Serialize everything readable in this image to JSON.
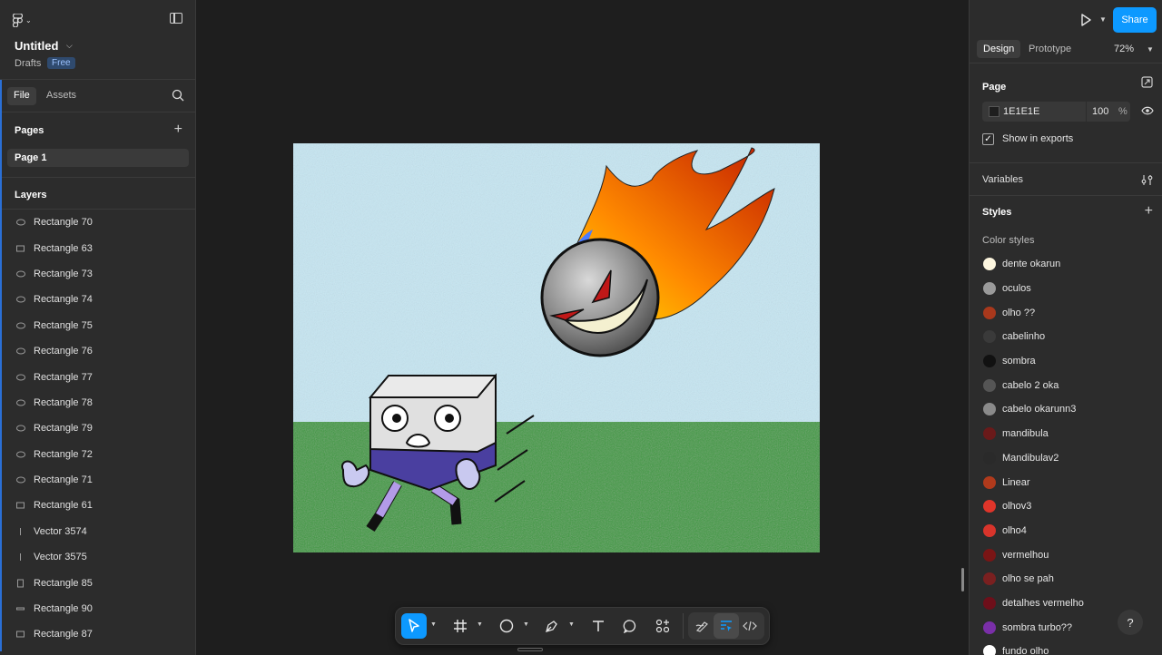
{
  "file": {
    "title": "Untitled",
    "location": "Drafts",
    "plan_badge": "Free"
  },
  "left_tabs": [
    {
      "label": "File"
    },
    {
      "label": "Assets"
    }
  ],
  "pages": {
    "title": "Pages",
    "items": [
      {
        "label": "Page 1"
      }
    ]
  },
  "layers": {
    "title": "Layers",
    "items": [
      {
        "label": "Rectangle 70",
        "icon": "ellipse"
      },
      {
        "label": "Rectangle 63",
        "icon": "rect"
      },
      {
        "label": "Rectangle 73",
        "icon": "ellipse"
      },
      {
        "label": "Rectangle 74",
        "icon": "ellipse"
      },
      {
        "label": "Rectangle 75",
        "icon": "ellipse"
      },
      {
        "label": "Rectangle 76",
        "icon": "ellipse"
      },
      {
        "label": "Rectangle 77",
        "icon": "ellipse"
      },
      {
        "label": "Rectangle 78",
        "icon": "ellipse"
      },
      {
        "label": "Rectangle 79",
        "icon": "ellipse"
      },
      {
        "label": "Rectangle 72",
        "icon": "ellipse"
      },
      {
        "label": "Rectangle 71",
        "icon": "ellipse"
      },
      {
        "label": "Rectangle 61",
        "icon": "rect"
      },
      {
        "label": "Vector 3574",
        "icon": "vector"
      },
      {
        "label": "Vector 3575",
        "icon": "vector"
      },
      {
        "label": "Rectangle 85",
        "icon": "rect-tall"
      },
      {
        "label": "Rectangle 90",
        "icon": "rect-thin"
      },
      {
        "label": "Rectangle 87",
        "icon": "rect"
      }
    ]
  },
  "header_right": {
    "share_label": "Share"
  },
  "right_tabs": [
    {
      "label": "Design"
    },
    {
      "label": "Prototype"
    }
  ],
  "zoom": "72%",
  "page_props": {
    "title": "Page",
    "bg_hex": "1E1E1E",
    "bg_color": "#1e1e1e",
    "opacity": "100",
    "opacity_unit": "%",
    "show_in_exports_label": "Show in exports",
    "show_in_exports": true
  },
  "variables": {
    "title": "Variables"
  },
  "styles": {
    "title": "Styles",
    "subtitle": "Color styles",
    "items": [
      {
        "label": "dente okarun",
        "color": "#fdf6df"
      },
      {
        "label": "oculos",
        "color": "#9a9a9a"
      },
      {
        "label": "olho ??",
        "color": "#a8381c"
      },
      {
        "label": "cabelinho",
        "color": "#3a3a3a"
      },
      {
        "label": "sombra",
        "color": "#111111"
      },
      {
        "label": "cabelo 2 oka",
        "color": "#555555"
      },
      {
        "label": "cabelo okarunn3",
        "color": "#8a8a8a"
      },
      {
        "label": "mandibula",
        "color": "#6a1a1a"
      },
      {
        "label": "Mandibulav2",
        "color": "#2a2a2a"
      },
      {
        "label": "Linear",
        "color": "#b03a1c"
      },
      {
        "label": "olhov3",
        "color": "#e0352a"
      },
      {
        "label": "olho4",
        "color": "#d8342b"
      },
      {
        "label": "vermelhou",
        "color": "#7a1515"
      },
      {
        "label": "olho se pah",
        "color": "#7a2020"
      },
      {
        "label": "detalhes vermelho",
        "color": "#6e0f1a"
      },
      {
        "label": "sombra turbo??",
        "color": "#7a2fa8"
      },
      {
        "label": "fundo olho",
        "color": "#ffffff"
      }
    ]
  },
  "toolbar": {
    "tools": [
      "move-tool",
      "frame-tool",
      "shape-tool",
      "pen-tool",
      "text-tool",
      "comment-tool",
      "actions-tool"
    ],
    "modes": [
      "draw-mode",
      "design-mode",
      "dev-mode"
    ]
  },
  "help_label": "?"
}
